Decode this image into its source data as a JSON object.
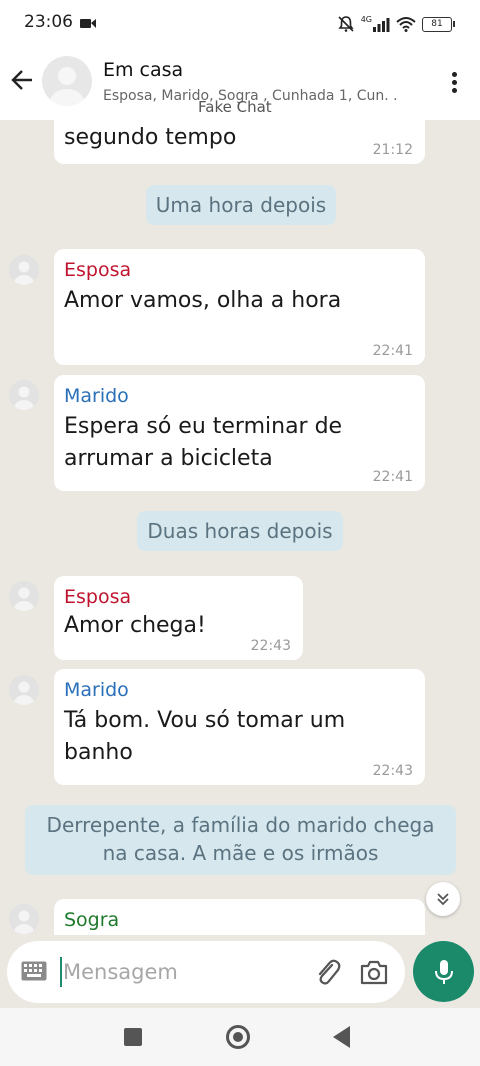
{
  "status_bar": {
    "time": "23:06",
    "network": "4G",
    "battery": "81"
  },
  "header": {
    "title": "Em casa",
    "members": "Esposa, Marido, Sogra , Cunhada 1, Cun. .",
    "watermark": "Fake Chat"
  },
  "messages": [
    {
      "text": "segundo tempo",
      "time": "21:12"
    },
    {
      "system": "Uma hora depois"
    },
    {
      "sender": "Esposa",
      "sender_color": "#c0152f",
      "text": "Amor vamos, olha a hora",
      "time": "22:41"
    },
    {
      "sender": "Marido",
      "sender_color": "#2a6fb8",
      "text": "Espera só eu terminar de arrumar a bicicleta",
      "time": "22:41"
    },
    {
      "system": "Duas horas depois"
    },
    {
      "sender": "Esposa",
      "sender_color": "#c0152f",
      "text": "Amor chega!",
      "time": "22:43"
    },
    {
      "sender": "Marido",
      "sender_color": "#2a6fb8",
      "text": "Tá bom. Vou só tomar um banho",
      "time": "22:43"
    },
    {
      "system": "Derrepente, a família do marido chega na casa. A mãe e os irmãos"
    },
    {
      "sender": "Sogra",
      "sender_color": "#1f7a2e"
    }
  ],
  "composer": {
    "placeholder": "Mensagem"
  },
  "colors": {
    "accent": "#1a8a6b",
    "system_bubble": "#d6e8ee",
    "background": "#ebe7e1"
  }
}
